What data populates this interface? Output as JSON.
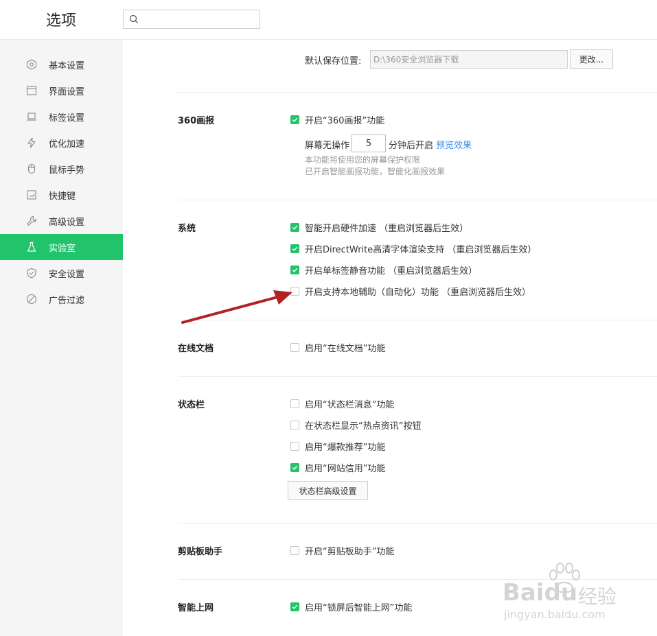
{
  "header": {
    "title": "选项",
    "search": {
      "placeholder": "",
      "value": ""
    }
  },
  "sidebar": {
    "items": [
      {
        "label": "基本设置",
        "icon": "hexagon-gear-icon",
        "active": false
      },
      {
        "label": "界面设置",
        "icon": "window-icon",
        "active": false
      },
      {
        "label": "标签设置",
        "icon": "laptop-tab-icon",
        "active": false
      },
      {
        "label": "优化加速",
        "icon": "lightning-icon",
        "active": false
      },
      {
        "label": "鼠标手势",
        "icon": "mouse-icon",
        "active": false
      },
      {
        "label": "快捷键",
        "icon": "keyboard-key-icon",
        "active": false
      },
      {
        "label": "高级设置",
        "icon": "wrench-icon",
        "active": false
      },
      {
        "label": "实验室",
        "icon": "flask-icon",
        "active": true
      },
      {
        "label": "安全设置",
        "icon": "shield-icon",
        "active": false
      },
      {
        "label": "广告过滤",
        "icon": "block-icon",
        "active": false
      }
    ]
  },
  "download": {
    "label": "默认保存位置:",
    "path": "D:\\360安全浏览器下载",
    "change_button": "更改..."
  },
  "huabao": {
    "title": "360画报",
    "enable_label": "开启“360画报”功能",
    "enable_checked": true,
    "idle_prefix": "屏幕无操作",
    "idle_minutes": "5",
    "idle_suffix": "分钟后开启",
    "preview_link": "预览效果",
    "hint1": "本功能将使用您的屏幕保护权限",
    "hint2": "已开启智能画报功能，智能化画报效果"
  },
  "system": {
    "title": "系统",
    "options": [
      {
        "label": "智能开启硬件加速 （重启浏览器后生效）",
        "checked": true
      },
      {
        "label": "开启DirectWrite高清字体渲染支持 （重启浏览器后生效）",
        "checked": true
      },
      {
        "label": "开启单标签静音功能 （重启浏览器后生效）",
        "checked": true
      },
      {
        "label": "开启支持本地辅助（自动化）功能 （重启浏览器后生效）",
        "checked": false
      }
    ]
  },
  "online_docs": {
    "title": "在线文档",
    "options": [
      {
        "label": "启用“在线文档”功能",
        "checked": false
      }
    ]
  },
  "statusbar": {
    "title": "状态栏",
    "options": [
      {
        "label": "启用“状态栏消息”功能",
        "checked": false
      },
      {
        "label": "在状态栏显示“热点资讯”按钮",
        "checked": false
      },
      {
        "label": "启用“爆款推荐”功能",
        "checked": false
      },
      {
        "label": "启用“网站信用”功能",
        "checked": true
      }
    ],
    "advanced_button": "状态栏高级设置"
  },
  "clipboard": {
    "title": "剪贴板助手",
    "options": [
      {
        "label": "开启“剪贴板助手”功能",
        "checked": false
      }
    ]
  },
  "smart_net": {
    "title": "智能上网",
    "options": [
      {
        "label": "启用“锁屏后智能上网”功能",
        "checked": true
      }
    ]
  },
  "watermark": {
    "brand": "Bai",
    "brand2": "du",
    "brand_cn": "经验",
    "url": "jingyan.baidu.com"
  },
  "colors": {
    "accent": "#21c36b",
    "link": "#3a8ee6",
    "arrow": "#b22222"
  }
}
